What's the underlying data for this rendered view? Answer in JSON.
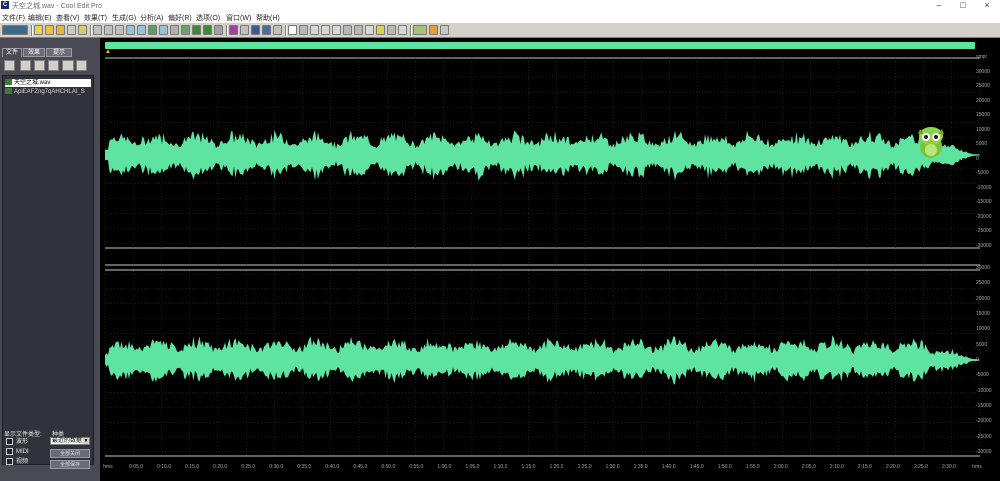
{
  "window": {
    "title": "天空之城.wav - Cool Edit Pro",
    "icon_glyph": "C",
    "controls": {
      "minimize": "–",
      "maximize": "□",
      "close": "×"
    }
  },
  "menu": [
    "文件(F)",
    "编辑(E)",
    "查看(V)",
    "效果(T)",
    "生成(G)",
    "分析(A)",
    "偏好(R)",
    "选项(O)",
    "窗口(W)",
    "帮助(H)"
  ],
  "left_panel": {
    "tabs": [
      "文件",
      "效果",
      "提示"
    ],
    "files": [
      {
        "name": "天空之城.wav",
        "selected": true
      },
      {
        "name": "ApiEAFZng7qAHCHLAI_S",
        "selected": false
      }
    ],
    "display_label": "显示文件类型:",
    "sort_label": "种类",
    "types": [
      "波形",
      "MIDI",
      "视频"
    ],
    "sort_value": "最近的数据",
    "buttons": [
      "全部关闭",
      "全部保存"
    ]
  },
  "waveform": {
    "color": "#5fe3a1",
    "channel_top_scale": [
      "smpl",
      "30000",
      "25000",
      "20000",
      "15000",
      "10000",
      "5000",
      "0",
      "-5000",
      "-10000",
      "-15000",
      "-20000",
      "-25000",
      "-30000"
    ],
    "channel_bottom_scale": [
      "30000",
      "25000",
      "20000",
      "15000",
      "10000",
      "5000",
      "0",
      "-5000",
      "-10000",
      "-15000",
      "-20000",
      "-25000",
      "-30000"
    ],
    "time_ticks": [
      "hms",
      "0:05.0",
      "0:10.0",
      "0:15.0",
      "0:20.0",
      "0:25.0",
      "0:30.0",
      "0:35.0",
      "0:40.0",
      "0:45.0",
      "0:50.0",
      "0:55.0",
      "1:00.0",
      "1:05.0",
      "1:10.0",
      "1:15.0",
      "1:20.0",
      "1:25.0",
      "1:30.0",
      "1:35.0",
      "1:40.0",
      "1:45.0",
      "1:50.0",
      "1:55.0",
      "2:00.0",
      "2:05.0",
      "2:10.0",
      "2:15.0",
      "2:20.0",
      "2:25.0",
      "2:30.0",
      "hms"
    ],
    "overview_marker": "▲"
  }
}
